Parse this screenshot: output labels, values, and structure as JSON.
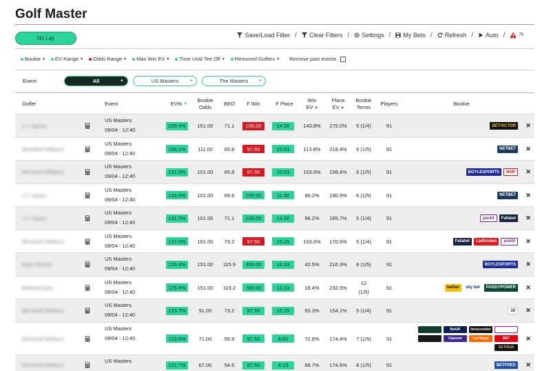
{
  "app_title": "Golf Master",
  "no_lay_label": "No Lay",
  "toolbar": [
    {
      "label": "Save/Load Filter",
      "icon": "filter-icon"
    },
    {
      "label": "Clear Filters",
      "icon": "filter-icon"
    },
    {
      "label": "Settings",
      "icon": "gear-icon"
    },
    {
      "label": "My Bets",
      "icon": "save-icon"
    },
    {
      "label": "Refresh",
      "icon": "refresh-icon"
    },
    {
      "label": "Auto",
      "icon": "play-icon"
    }
  ],
  "warning_count": "79",
  "filters": [
    {
      "label": "Bookie",
      "color": "#2bd49a"
    },
    {
      "label": "EV Range",
      "color": "#2bd49a"
    },
    {
      "label": "Odds Range",
      "color": "#d51920"
    },
    {
      "label": "Max Win EV",
      "color": "#2bd49a"
    },
    {
      "label": "Time Until Tee Off",
      "color": "#2bd49a"
    },
    {
      "label": "Removed Golfers",
      "color": "#2bd49a"
    }
  ],
  "remove_past_label": "Remove past events",
  "event_filter": {
    "label": "Event:",
    "pills": [
      "All",
      "US Masters",
      "The Masters"
    ]
  },
  "columns": {
    "golfer": "Golfer",
    "event": "Event",
    "ev_pct": "EV%",
    "bookie_odds": [
      "Bookie",
      "Odds"
    ],
    "beo": "BEO",
    "f_win": "F Win",
    "f_place": "F Place",
    "win_ev": [
      "Win",
      "EV"
    ],
    "place_ev": [
      "Place",
      "EV"
    ],
    "bookie_terms": [
      "Bookie",
      "Terms"
    ],
    "players": "Players",
    "bookie": "Bookie"
  },
  "rows": [
    {
      "golfer": "J.J. Spaun",
      "event": "US Masters",
      "date": "09/04 - 12:40",
      "ev": "209.4%",
      "odds": "151.00",
      "beo": "71.1",
      "fwin": "105.00",
      "fwin_red": true,
      "fplace": "14.00",
      "winev": "143.8%",
      "placeev": "275.0%",
      "terms": "5 (1/4)",
      "players": "91",
      "bookies": [
        "betvictor"
      ]
    },
    {
      "golfer": "Bernhard Williams",
      "event": "US Masters",
      "date": "09/04 - 12:40",
      "ev": "166.1%",
      "odds": "111.00",
      "beo": "65.8",
      "fwin": "97.50",
      "fwin_red": true,
      "fplace": "10.53",
      "winev": "113.8%",
      "placeev": "218.4%",
      "terms": "6 (1/5)",
      "players": "91",
      "bookies": [
        "netbet"
      ]
    },
    {
      "golfer": "Bernhard Williams",
      "event": "US Masters",
      "date": "09/04 - 12:40",
      "ev": "151.5%",
      "odds": "101.00",
      "beo": "65.8",
      "fwin": "97.50",
      "fwin_red": true,
      "fplace": "10.53",
      "winev": "103.6%",
      "placeev": "199.4%",
      "terms": "6 (1/5)",
      "players": "91",
      "bookies": [
        "boylesports",
        "bar"
      ]
    },
    {
      "golfer": "J.J. Spaun",
      "event": "US Masters",
      "date": "09/04 - 12:40",
      "ev": "143.5%",
      "odds": "101.00",
      "beo": "69.6",
      "fwin": "105.00",
      "fwin_red": false,
      "fplace": "11.00",
      "winev": "96.2%",
      "placeev": "190.9%",
      "terms": "6 (1/5)",
      "players": "91",
      "bookies": [
        "netbet"
      ]
    },
    {
      "golfer": "J.J. Spaun",
      "event": "US Masters",
      "date": "09/04 - 12:40",
      "ev": "141.0%",
      "odds": "101.00",
      "beo": "71.1",
      "fwin": "105.00",
      "fwin_red": false,
      "fplace": "14.00",
      "winev": "96.2%",
      "placeev": "185.7%",
      "terms": "5 (1/4)",
      "players": "91",
      "bookies": [
        "puntit",
        "fafabet"
      ]
    },
    {
      "golfer": "Bernhard Williams",
      "event": "US Masters",
      "date": "09/04 - 12:40",
      "ev": "137.0%",
      "odds": "101.00",
      "beo": "73.2",
      "fwin": "97.50",
      "fwin_red": true,
      "fplace": "15.25",
      "winev": "103.6%",
      "placeev": "170.5%",
      "terms": "5 (1/4)",
      "players": "91",
      "bookies": [
        "fafabet",
        "ladbrokes",
        "puntit"
      ]
    },
    {
      "golfer": "Ryan Gerard",
      "event": "US Masters",
      "date": "09/04 - 12:40",
      "ev": "129.4%",
      "odds": "151.00",
      "beo": "115.9",
      "fwin": "355.00",
      "fwin_red": false,
      "fplace": "14.33",
      "winev": "42.5%",
      "placeev": "216.3%",
      "terms": "8 (1/5)",
      "players": "91",
      "bookies": [
        "boylesports"
      ]
    },
    {
      "golfer": "Matt McCarty",
      "event": "US Masters",
      "date": "09/04 - 12:40",
      "ev": "125.9%",
      "odds": "151.00",
      "beo": "119.2",
      "fwin": "780.00",
      "fwin_red": false,
      "fplace": "13.33",
      "winev": "19.4%",
      "placeev": "232.5%",
      "terms": "12 (1/5)",
      "terms_wrap": true,
      "players": "91",
      "bookies": [
        "betfair",
        "skybet",
        "paddypower"
      ]
    },
    {
      "golfer": "Bernhard Williams",
      "event": "US Masters",
      "date": "09/04 - 12:40",
      "ev": "123.7%",
      "odds": "91.00",
      "beo": "73.2",
      "fwin": "97.50",
      "fwin_red": false,
      "fplace": "15.25",
      "winev": "93.3%",
      "placeev": "154.1%",
      "terms": "5 (1/4)",
      "players": "91",
      "bookies": [
        "10bet"
      ]
    },
    {
      "golfer": "Bernhard Williams",
      "event": "US Masters",
      "date": "09/04 - 12:40",
      "ev": "123.6%",
      "odds": "71.00",
      "beo": "56.9",
      "fwin": "97.50",
      "fwin_red": false,
      "fplace": "8.60",
      "winev": "72.8%",
      "placeev": "174.4%",
      "terms": "7 (1/5)",
      "players": "91",
      "bookies": [
        "bookie-a",
        "betuk",
        "livescorebet",
        "bookie-b",
        "bookie-c",
        "casumo",
        "leovegas",
        "ybet",
        "betmgm"
      ]
    },
    {
      "golfer": "Bernhard Williams",
      "event": "US Masters",
      "date": "",
      "ev": "121.7%",
      "odds": "67.00",
      "beo": "54.6",
      "fwin": "97.50",
      "fwin_red": false,
      "fplace": "8.13",
      "winev": "68.7%",
      "placeev": "174.6%",
      "terms": "8 (1/5)",
      "players": "91",
      "bookies": [
        "betfred"
      ]
    }
  ],
  "bookie_logos": {
    "betvictor": {
      "text": "BETVICTOR",
      "bg": "#111111",
      "fg": "#f5c400"
    },
    "netbet": {
      "text": "NETBET",
      "bg": "#1b3a5c",
      "fg": "#ffffff"
    },
    "boylesports": {
      "text": "BOYLESPORTS",
      "bg": "#1e2a9e",
      "fg": "#ffffff"
    },
    "bar": {
      "text": "BAR",
      "bg": "#ffffff",
      "fg": "#d51920",
      "border": "#d51920"
    },
    "puntit": {
      "text": "puntit",
      "bg": "#ffffff",
      "fg": "#7a1fa2",
      "border": "#7a1fa2"
    },
    "fafabet": {
      "text": "Fafabet",
      "bg": "#15233b",
      "fg": "#ffffff"
    },
    "ladbrokes": {
      "text": "Ladbrokes",
      "bg": "#e3161b",
      "fg": "#ffffff"
    },
    "betfair": {
      "text": "betfair",
      "bg": "#f7c300",
      "fg": "#111111"
    },
    "skybet": {
      "text": "sky bet",
      "bg": "#ffffff",
      "fg": "#003b8f"
    },
    "paddypower": {
      "text": "PADDYPOWER",
      "bg": "#004833",
      "fg": "#ffffff"
    },
    "10bet": {
      "text": "10",
      "bg": "#ffffff",
      "fg": "#111111",
      "border": "#cccccc"
    },
    "bookie-a": {
      "text": "",
      "bg": "#123d2a",
      "fg": "#f5c400"
    },
    "betuk": {
      "text": "BetUK",
      "bg": "#0b1f4d",
      "fg": "#ffffff"
    },
    "livescorebet": {
      "text": "livescorebet",
      "bg": "#111111",
      "fg": "#ffffff"
    },
    "bookie-b": {
      "text": "",
      "bg": "#ffffff",
      "fg": "#e6007e",
      "border": "#e6007e"
    },
    "bookie-c": {
      "text": "",
      "bg": "#1a1a1a",
      "fg": "#e30613"
    },
    "casumo": {
      "text": "Casumo",
      "bg": "#3f2a8c",
      "fg": "#ffffff"
    },
    "leovegas": {
      "text": "LeoVegas",
      "bg": "#ff6b00",
      "fg": "#ffffff"
    },
    "ybet": {
      "text": "BET",
      "bg": "#e30613",
      "fg": "#ffffff"
    },
    "betmgm": {
      "text": "BETMGM",
      "bg": "#111111",
      "fg": "#c8a96a"
    },
    "betfred": {
      "text": "BETFRED",
      "bg": "#1d4ea8",
      "fg": "#ffffff"
    }
  },
  "colors": {
    "accent_green": "#2bd49a",
    "odds_red": "#d51920",
    "warning_red": "#d51920"
  }
}
